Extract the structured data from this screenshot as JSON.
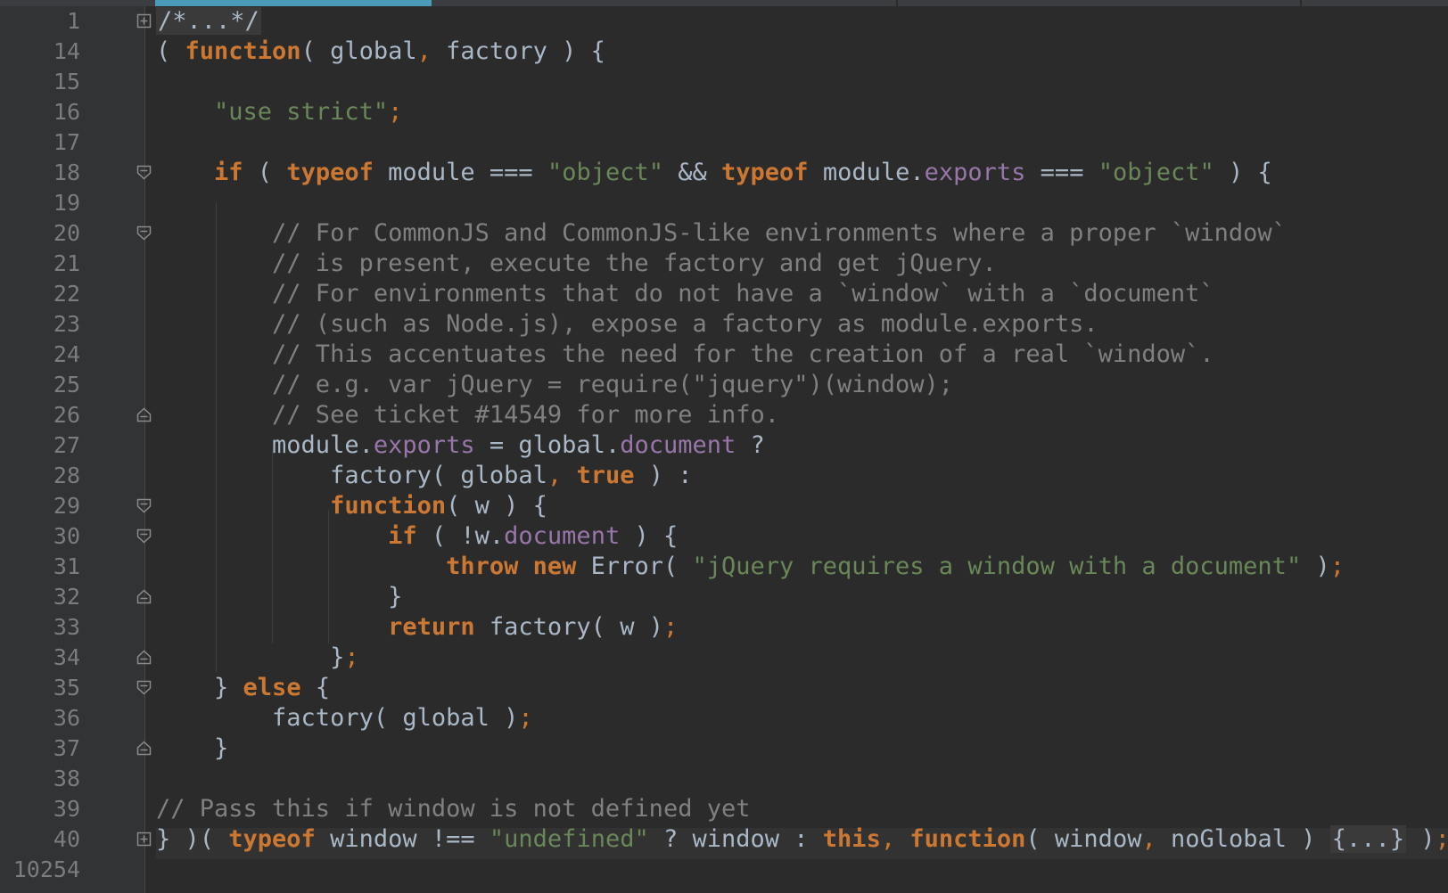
{
  "editor": {
    "gutter": {
      "line_numbers": [
        "1",
        "14",
        "15",
        "16",
        "17",
        "18",
        "19",
        "20",
        "21",
        "22",
        "23",
        "24",
        "25",
        "26",
        "27",
        "28",
        "29",
        "30",
        "31",
        "32",
        "33",
        "34",
        "35",
        "36",
        "37",
        "38",
        "39",
        "40",
        "10254"
      ]
    },
    "code_lines": [
      [
        {
          "t": "/*...*/",
          "c": "cmt fc"
        }
      ],
      [
        {
          "t": "( ",
          "c": ""
        },
        {
          "t": "function",
          "c": "kw"
        },
        {
          "t": "( global",
          "c": ""
        },
        {
          "t": ",",
          "c": "pun"
        },
        {
          "t": " factory ) {",
          "c": ""
        }
      ],
      [],
      [
        {
          "t": "    ",
          "c": ""
        },
        {
          "t": "\"use strict\"",
          "c": "str"
        },
        {
          "t": ";",
          "c": "pun"
        }
      ],
      [],
      [
        {
          "t": "    ",
          "c": ""
        },
        {
          "t": "if",
          "c": "kw"
        },
        {
          "t": " ( ",
          "c": ""
        },
        {
          "t": "typeof",
          "c": "kw"
        },
        {
          "t": " module === ",
          "c": ""
        },
        {
          "t": "\"object\"",
          "c": "str"
        },
        {
          "t": " && ",
          "c": ""
        },
        {
          "t": "typeof",
          "c": "kw"
        },
        {
          "t": " module.",
          "c": ""
        },
        {
          "t": "exports",
          "c": "prop"
        },
        {
          "t": " === ",
          "c": ""
        },
        {
          "t": "\"object\"",
          "c": "str"
        },
        {
          "t": " ) {",
          "c": ""
        }
      ],
      [],
      [
        {
          "t": "        // For CommonJS and CommonJS-like environments where a proper `window`",
          "c": "cmt"
        }
      ],
      [
        {
          "t": "        // is present, execute the factory and get jQuery.",
          "c": "cmt"
        }
      ],
      [
        {
          "t": "        // For environments that do not have a `window` with a `document`",
          "c": "cmt"
        }
      ],
      [
        {
          "t": "        // (such as Node.js), expose a factory as module.exports.",
          "c": "cmt"
        }
      ],
      [
        {
          "t": "        // This accentuates the need for the creation of a real `window`.",
          "c": "cmt"
        }
      ],
      [
        {
          "t": "        // e.g. var jQuery = require(\"jquery\")(window);",
          "c": "cmt"
        }
      ],
      [
        {
          "t": "        // See ticket #14549 for more info.",
          "c": "cmt"
        }
      ],
      [
        {
          "t": "        module.",
          "c": ""
        },
        {
          "t": "exports",
          "c": "prop"
        },
        {
          "t": " = global.",
          "c": ""
        },
        {
          "t": "document",
          "c": "prop"
        },
        {
          "t": " ?",
          "c": ""
        }
      ],
      [
        {
          "t": "            factory( global",
          "c": ""
        },
        {
          "t": ",",
          "c": "pun"
        },
        {
          "t": " ",
          "c": ""
        },
        {
          "t": "true",
          "c": "kw"
        },
        {
          "t": " ) :",
          "c": ""
        }
      ],
      [
        {
          "t": "            ",
          "c": ""
        },
        {
          "t": "function",
          "c": "kw"
        },
        {
          "t": "( w ) {",
          "c": ""
        }
      ],
      [
        {
          "t": "                ",
          "c": ""
        },
        {
          "t": "if",
          "c": "kw"
        },
        {
          "t": " ( !w.",
          "c": ""
        },
        {
          "t": "document",
          "c": "prop"
        },
        {
          "t": " ) {",
          "c": ""
        }
      ],
      [
        {
          "t": "                    ",
          "c": ""
        },
        {
          "t": "throw new",
          "c": "kw"
        },
        {
          "t": " Error( ",
          "c": ""
        },
        {
          "t": "\"jQuery requires a window with a document\"",
          "c": "str"
        },
        {
          "t": " )",
          "c": ""
        },
        {
          "t": ";",
          "c": "pun"
        }
      ],
      [
        {
          "t": "                }",
          "c": ""
        }
      ],
      [
        {
          "t": "                ",
          "c": ""
        },
        {
          "t": "return",
          "c": "kw"
        },
        {
          "t": " factory( w )",
          "c": ""
        },
        {
          "t": ";",
          "c": "pun"
        }
      ],
      [
        {
          "t": "            }",
          "c": ""
        },
        {
          "t": ";",
          "c": "pun"
        }
      ],
      [
        {
          "t": "    } ",
          "c": ""
        },
        {
          "t": "else",
          "c": "kw"
        },
        {
          "t": " {",
          "c": ""
        }
      ],
      [
        {
          "t": "        factory( global )",
          "c": ""
        },
        {
          "t": ";",
          "c": "pun"
        }
      ],
      [
        {
          "t": "    }",
          "c": ""
        }
      ],
      [],
      [
        {
          "t": "// Pass this if window is not defined yet",
          "c": "cmt"
        }
      ],
      [
        {
          "t": "} )( ",
          "c": ""
        },
        {
          "t": "typeof",
          "c": "kw"
        },
        {
          "t": " window !== ",
          "c": ""
        },
        {
          "t": "\"undefined\"",
          "c": "str"
        },
        {
          "t": " ? window : ",
          "c": ""
        },
        {
          "t": "this",
          "c": "kw"
        },
        {
          "t": ",",
          "c": "pun"
        },
        {
          "t": " ",
          "c": ""
        },
        {
          "t": "function",
          "c": "kw"
        },
        {
          "t": "( window",
          "c": ""
        },
        {
          "t": ",",
          "c": "pun"
        },
        {
          "t": " noGlobal ) ",
          "c": ""
        },
        {
          "t": "{...}",
          "c": "fc"
        },
        {
          "t": " )",
          "c": ""
        },
        {
          "t": ";",
          "c": "pun"
        }
      ],
      []
    ],
    "fold_markers": [
      {
        "line_index": 0,
        "kind": "expand"
      },
      {
        "line_index": 5,
        "kind": "open"
      },
      {
        "line_index": 7,
        "kind": "open"
      },
      {
        "line_index": 13,
        "kind": "close"
      },
      {
        "line_index": 16,
        "kind": "open"
      },
      {
        "line_index": 17,
        "kind": "open"
      },
      {
        "line_index": 19,
        "kind": "close"
      },
      {
        "line_index": 21,
        "kind": "close"
      },
      {
        "line_index": 22,
        "kind": "open"
      },
      {
        "line_index": 24,
        "kind": "close"
      },
      {
        "line_index": 27,
        "kind": "expand"
      }
    ],
    "caret_line_index": 27,
    "colors": {
      "background": "#2b2b2b",
      "gutter": "#313335",
      "keyword": "#cc7832",
      "string": "#6a8759",
      "comment": "#808080",
      "property": "#9876aa",
      "default_text": "#a9b7c6",
      "tab_accent": "#4a9bb8"
    }
  }
}
